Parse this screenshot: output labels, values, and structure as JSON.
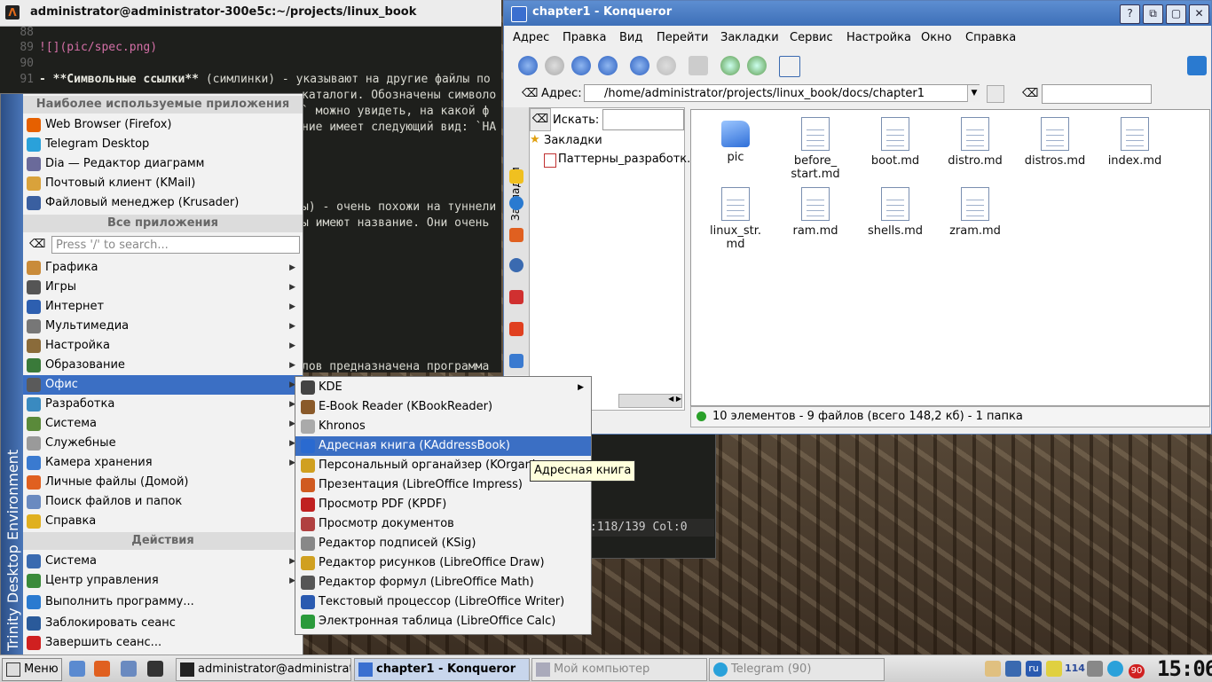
{
  "terminal": {
    "title": "administrator@administrator-300e5c:~/projects/linux_book",
    "lines": [
      {
        "num": "88",
        "text": ""
      },
      {
        "num": "89",
        "text": "![](pic/spec.png)"
      },
      {
        "num": "90",
        "text": ""
      },
      {
        "num": "91",
        "text_bold": "- **Символьные ссылки**",
        "text_rest": " (симлинки) - указывают на другие файлы по"
      }
    ],
    "fragments": [
      "каталоги. Обозначены символо",
      "` можно увидеть, на какой ф",
      "ние имеет следующий вид: `НА",
      "ы) - очень похожи на туннели",
      "ы имеют название. Они очень",
      "лов предназначена программа"
    ],
    "status_text": ":118/139 Col:0"
  },
  "konqueror": {
    "title": "chapter1 - Konqueror",
    "menu": [
      "Адрес",
      "Правка",
      "Вид",
      "Перейти",
      "Закладки",
      "Сервис",
      "Настройка",
      "Окно",
      "Справка"
    ],
    "address_label": "Адрес:",
    "address_value": "/home/administrator/projects/linux_book/docs/chapter1",
    "search_label": "Искать:",
    "sidebar_tab": "Закладки",
    "bookmarks_root": "Закладки",
    "bookmark_item": "Паттерны_разработк...",
    "files": [
      {
        "name": "pic",
        "type": "folder"
      },
      {
        "name": "before_\nstart.md",
        "type": "file"
      },
      {
        "name": "boot.md",
        "type": "file"
      },
      {
        "name": "distro.md",
        "type": "file"
      },
      {
        "name": "distros.md",
        "type": "file"
      },
      {
        "name": "index.md",
        "type": "file"
      },
      {
        "name": "linux_str.\nmd",
        "type": "file"
      },
      {
        "name": "ram.md",
        "type": "file"
      },
      {
        "name": "shells.md",
        "type": "file"
      },
      {
        "name": "zram.md",
        "type": "file"
      }
    ],
    "status": "10 элементов - 9 файлов (всего 148,2 кб) - 1 папка",
    "window_buttons": [
      "?",
      "⧉",
      "▢",
      "✕"
    ]
  },
  "kmenu": {
    "side_label": "Trinity Desktop Environment",
    "sec_frequent": "Наиболее используемые приложения",
    "frequent": [
      {
        "label": "Web Browser (Firefox)",
        "color": "#e66000"
      },
      {
        "label": "Telegram Desktop",
        "color": "#2aa1da"
      },
      {
        "label": "Dia — Редактор диаграмм",
        "color": "#6a6a9a"
      },
      {
        "label": "Почтовый клиент (KMail)",
        "color": "#d9a23b"
      },
      {
        "label": "Файловый менеджер (Krusader)",
        "color": "#3a5fa0"
      }
    ],
    "sec_all": "Все приложения",
    "search_placeholder": "Press '/' to search...",
    "categories": [
      {
        "label": "Графика",
        "color": "#c98b3a"
      },
      {
        "label": "Игры",
        "color": "#555"
      },
      {
        "label": "Интернет",
        "color": "#2d5fb0"
      },
      {
        "label": "Мультимедиа",
        "color": "#777"
      },
      {
        "label": "Настройка",
        "color": "#8a6b3a"
      },
      {
        "label": "Образование",
        "color": "#3a7a3a"
      },
      {
        "label": "Офис",
        "color": "#5a5a5a"
      },
      {
        "label": "Разработка",
        "color": "#3a8ac0"
      },
      {
        "label": "Система",
        "color": "#5a8a3a"
      },
      {
        "label": "Служебные",
        "color": "#9a9a9a"
      },
      {
        "label": "Камера хранения",
        "color": "#3a7ad0"
      },
      {
        "label": "Личные файлы (Домой)",
        "color": "#e06020"
      },
      {
        "label": "Поиск файлов и папок",
        "color": "#6a8ac0"
      },
      {
        "label": "Справка",
        "color": "#e0b020"
      }
    ],
    "sec_actions": "Действия",
    "actions": [
      {
        "label": "Система",
        "color": "#3a6ab0",
        "arrow": true
      },
      {
        "label": "Центр управления",
        "color": "#3a8a3a",
        "arrow": true
      },
      {
        "label": "Выполнить программу...",
        "color": "#2a7ad0",
        "arrow": false
      },
      {
        "label": "Заблокировать сеанс",
        "color": "#2a5a9a",
        "arrow": false
      },
      {
        "label": "Завершить сеанс...",
        "color": "#d02020",
        "arrow": false
      }
    ],
    "arrow": "▶"
  },
  "office_submenu": {
    "items": [
      {
        "label": "KDE",
        "color": "#444",
        "arrow": true
      },
      {
        "label": "E-Book Reader (KBookReader)",
        "color": "#8a5a2a",
        "arrow": false
      },
      {
        "label": "Khronos",
        "color": "#aaa",
        "arrow": false
      },
      {
        "label": "Адресная книга (KAddressBook)",
        "color": "#2a6ad0",
        "arrow": false
      },
      {
        "label": "Персональный органайзер (KOrganiz",
        "color": "#d0a020",
        "arrow": false
      },
      {
        "label": "Презентация (LibreOffice Impress)",
        "color": "#d05a20",
        "arrow": false
      },
      {
        "label": "Просмотр PDF (KPDF)",
        "color": "#c02020",
        "arrow": false
      },
      {
        "label": "Просмотр документов",
        "color": "#b04040",
        "arrow": false
      },
      {
        "label": "Редактор подписей (KSig)",
        "color": "#888",
        "arrow": false
      },
      {
        "label": "Редактор рисунков (LibreOffice Draw)",
        "color": "#d0a020",
        "arrow": false
      },
      {
        "label": "Редактор формул (LibreOffice Math)",
        "color": "#555",
        "arrow": false
      },
      {
        "label": "Текстовый процессор (LibreOffice Writer)",
        "color": "#2a5ab0",
        "arrow": false
      },
      {
        "label": "Электронная таблица (LibreOffice Calc)",
        "color": "#2a9a3a",
        "arrow": false
      }
    ],
    "tooltip": "Адресная книга"
  },
  "taskbar": {
    "menu_label": "Меню",
    "tasks": [
      {
        "label": "administrator@administrat",
        "state": "normal"
      },
      {
        "label": "chapter1 - Konqueror",
        "state": "active"
      },
      {
        "label": "Мой компьютер",
        "state": "dim"
      },
      {
        "label": "Telegram (90)",
        "state": "dim"
      }
    ],
    "tray": {
      "lang": "ru",
      "battery": "114",
      "badge": "90"
    },
    "clock": "15:06"
  },
  "colors": {
    "selection": "#3b6fc4",
    "titlebar": "#3d6fb8"
  }
}
